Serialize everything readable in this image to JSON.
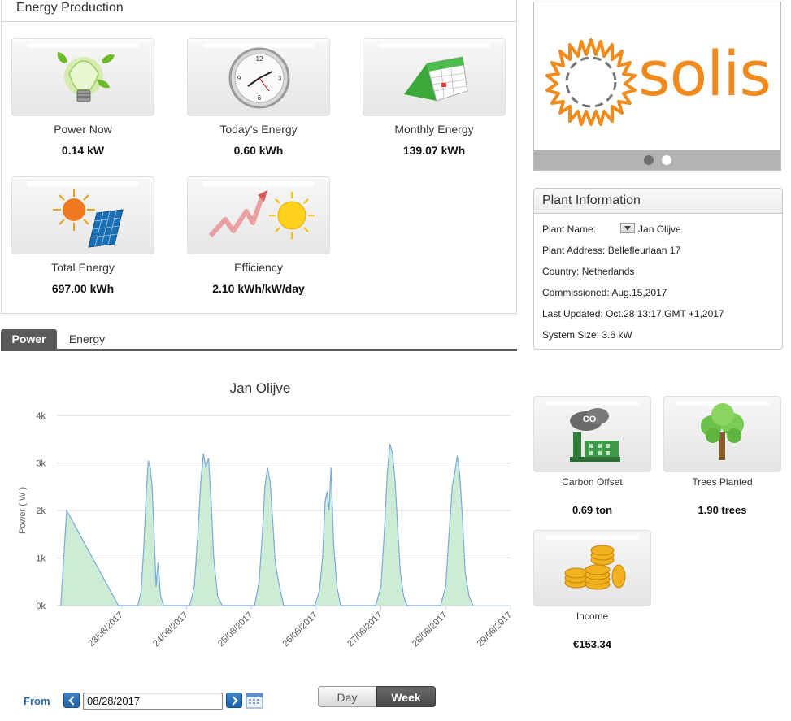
{
  "energy_production": {
    "title": "Energy Production",
    "tiles": [
      {
        "label": "Power Now",
        "value": "0.14 kW",
        "icon": "lightbulb-icon"
      },
      {
        "label": "Today's Energy",
        "value": "0.60 kWh",
        "icon": "clock-icon"
      },
      {
        "label": "Monthly Energy",
        "value": "139.07 kWh",
        "icon": "calendar-icon"
      },
      {
        "label": "Total Energy",
        "value": "697.00 kWh",
        "icon": "sun-solar-panel-icon"
      },
      {
        "label": "Efficiency",
        "value": "2.10 kWh/kW/day",
        "icon": "growth-arrow-sun-icon"
      }
    ]
  },
  "logo": {
    "brand": "solis",
    "color": "#f08a1c",
    "carousel_dots": 2,
    "active_dot": 0
  },
  "plant_info": {
    "title": "Plant Information",
    "rows": [
      {
        "key": "Plant Name:",
        "value": "Jan Olijve"
      },
      {
        "key": "Plant Address:",
        "value": "Bellefleurlaan 17"
      },
      {
        "key": "Country:",
        "value": "Netherlands"
      },
      {
        "key": "Commissioned:",
        "value": "Aug.15,2017"
      },
      {
        "key": "Last Updated:",
        "value": "Oct.28 13:17,GMT +1,2017"
      },
      {
        "key": "System Size:",
        "value": "3.6 kW"
      }
    ]
  },
  "tabs": [
    {
      "label": "Power",
      "active": true
    },
    {
      "label": "Energy",
      "active": false
    }
  ],
  "chart_data": {
    "type": "area",
    "title": "Jan Olijve",
    "ylabel": "Power ( W )",
    "ylim": [
      0,
      4000
    ],
    "yticks": [
      {
        "value": 0,
        "label": "0k"
      },
      {
        "value": 1000,
        "label": "1k"
      },
      {
        "value": 2000,
        "label": "2k"
      },
      {
        "value": 3000,
        "label": "3k"
      },
      {
        "value": 4000,
        "label": "4k"
      }
    ],
    "xlabels": [
      "23/08/2017",
      "24/08/2017",
      "25/08/2017",
      "26/08/2017",
      "27/08/2017",
      "28/08/2017",
      "29/08/2017"
    ],
    "x_unit": "days since 22/08/2017 00:00",
    "grid": true,
    "colors": {
      "line": "#7aa9dc",
      "fill": "#c8ead0"
    },
    "series": [
      {
        "name": "Power",
        "points": [
          [
            0.06,
            0
          ],
          [
            0.15,
            2000
          ],
          [
            0.95,
            0
          ],
          [
            1.25,
            0
          ],
          [
            1.3,
            300
          ],
          [
            1.34,
            1200
          ],
          [
            1.38,
            2400
          ],
          [
            1.41,
            3050
          ],
          [
            1.44,
            2900
          ],
          [
            1.47,
            2500
          ],
          [
            1.5,
            1500
          ],
          [
            1.53,
            400
          ],
          [
            1.56,
            900
          ],
          [
            1.6,
            200
          ],
          [
            1.65,
            0
          ],
          [
            2.05,
            0
          ],
          [
            2.12,
            400
          ],
          [
            2.17,
            1400
          ],
          [
            2.22,
            2600
          ],
          [
            2.26,
            3200
          ],
          [
            2.3,
            2900
          ],
          [
            2.34,
            3100
          ],
          [
            2.38,
            2200
          ],
          [
            2.42,
            1000
          ],
          [
            2.48,
            200
          ],
          [
            2.55,
            0
          ],
          [
            3.05,
            0
          ],
          [
            3.12,
            500
          ],
          [
            3.17,
            1500
          ],
          [
            3.21,
            2500
          ],
          [
            3.25,
            2900
          ],
          [
            3.29,
            2600
          ],
          [
            3.33,
            1800
          ],
          [
            3.37,
            900
          ],
          [
            3.42,
            500
          ],
          [
            3.5,
            0
          ],
          [
            3.98,
            0
          ],
          [
            4.05,
            300
          ],
          [
            4.1,
            1000
          ],
          [
            4.14,
            2200
          ],
          [
            4.17,
            2400
          ],
          [
            4.2,
            2000
          ],
          [
            4.23,
            2900
          ],
          [
            4.27,
            1300
          ],
          [
            4.32,
            400
          ],
          [
            4.38,
            0
          ],
          [
            4.92,
            0
          ],
          [
            5.0,
            400
          ],
          [
            5.05,
            1500
          ],
          [
            5.1,
            2800
          ],
          [
            5.14,
            3400
          ],
          [
            5.18,
            3200
          ],
          [
            5.22,
            2600
          ],
          [
            5.26,
            1600
          ],
          [
            5.3,
            700
          ],
          [
            5.35,
            200
          ],
          [
            5.4,
            0
          ],
          [
            5.92,
            0
          ],
          [
            6.0,
            400
          ],
          [
            6.05,
            1500
          ],
          [
            6.1,
            2500
          ],
          [
            6.14,
            2800
          ],
          [
            6.18,
            3150
          ],
          [
            6.22,
            2700
          ],
          [
            6.26,
            1800
          ],
          [
            6.3,
            700
          ],
          [
            6.36,
            200
          ],
          [
            6.42,
            0
          ]
        ]
      }
    ]
  },
  "controls": {
    "from_label": "From",
    "date_value": "08/28/2017",
    "day_label": "Day",
    "week_label": "Week",
    "active_range": "Week"
  },
  "environment": [
    {
      "label": "Carbon Offset",
      "value": "0.69 ton",
      "icon": "co2-factory-icon"
    },
    {
      "label": "Trees Planted",
      "value": "1.90 trees",
      "icon": "tree-icon"
    },
    {
      "label": "Income",
      "value": "€153.34",
      "icon": "coins-icon"
    }
  ]
}
